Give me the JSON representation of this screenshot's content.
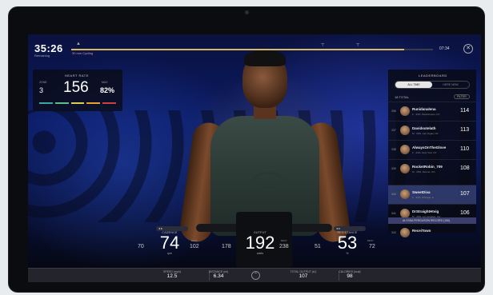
{
  "header": {
    "timer": "35:26",
    "timer_sub": "Remaining",
    "class_title": "30 min Cycling",
    "progress": 0.92,
    "time_left": "07:34"
  },
  "heart_rate": {
    "title": "HEART RATE",
    "zone_label": "ZONE",
    "zone": "3",
    "bpm": "156",
    "bpm_unit": "BPM",
    "pct_label": "MAX",
    "pct": "82%",
    "zone_colors": [
      "#3aa8a0",
      "#58c08a",
      "#d8d050",
      "#e8a030",
      "#d04040"
    ]
  },
  "leaderboard": {
    "title": "LEADERBOARD",
    "tabs": [
      "ALL TIME",
      "HERE NOW"
    ],
    "count": "18 TOTAL",
    "filter": "FILTER",
    "rows": [
      {
        "rank": "336",
        "name": "Runidanalena",
        "meta": "F · 33%, Westchester, NY",
        "score": "114"
      },
      {
        "rank": "337",
        "name": "Davidsotelath",
        "meta": "M · 33%, Las Vegas, NV",
        "score": "113"
      },
      {
        "rank": "338",
        "name": "AlwaysOnTheGlove",
        "meta": "F · 23%, New York, NY",
        "score": "110"
      },
      {
        "rank": "339",
        "name": "RocketRobin_709",
        "meta": "M · 30%, Denver, CO",
        "score": "108"
      },
      {
        "rank": "340",
        "name": "SweetDiva",
        "meta": "F · 33%, Chicago, IL",
        "score": "107"
      },
      {
        "rank": "341",
        "name": "DrStraightHtvig",
        "meta": "M · 33%, Los Angeles, CA",
        "score": "106"
      },
      {
        "rank": "342",
        "name": "ReceiTown",
        "meta": "",
        "score": ""
      }
    ],
    "banner": "ALYSSA FERGUSON  RECORD (150)"
  },
  "metrics": [
    {
      "label": "CADENCE",
      "value": "74",
      "unit": "rpm",
      "left": "70",
      "right": "102",
      "right_label": "BEST"
    },
    {
      "label": "OUTPUT",
      "value": "192",
      "unit": "watts",
      "left": "178",
      "right": "238",
      "right_label": "BEST"
    },
    {
      "label": "RESISTANCE",
      "value": "53",
      "unit": "%",
      "left": "51",
      "right": "72",
      "right_label": "BEST"
    }
  ],
  "footer": [
    {
      "label": "SPEED (mph)",
      "value": "12.5"
    },
    {
      "label": "DISTANCE (mi)",
      "value": "6.34"
    },
    {
      "label": "TOTAL OUTPUT (kJ)",
      "value": "107"
    },
    {
      "label": "CALORIES (kcal)",
      "value": "98"
    }
  ],
  "icons": {
    "close": "✕",
    "chevron": "⌃"
  }
}
